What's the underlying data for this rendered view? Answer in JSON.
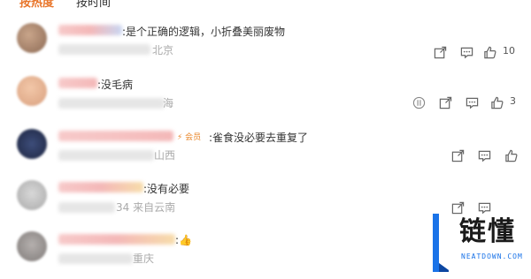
{
  "tabs": {
    "active": "按热度",
    "inactive": "按时间"
  },
  "comments": [
    {
      "text": ":是个正确的逻辑，小折叠美丽废物",
      "meta": "北京",
      "likes": "10"
    },
    {
      "text": ":没毛病",
      "meta": "海",
      "likes": "3"
    },
    {
      "text": ":雀食没必要去重复了",
      "meta": "山西",
      "likes": "",
      "badge": "⚡ 会员"
    },
    {
      "text": ":没有必要",
      "meta": "34 来自云南",
      "likes": ""
    },
    {
      "text": ":👍",
      "meta": "重庆",
      "likes": ""
    }
  ],
  "watermark": {
    "title": "链懂",
    "subtitle": "NEATDOWN.COM"
  },
  "colors": {
    "accent": "#e8752a",
    "watermark_blue": "#1a73e8"
  }
}
